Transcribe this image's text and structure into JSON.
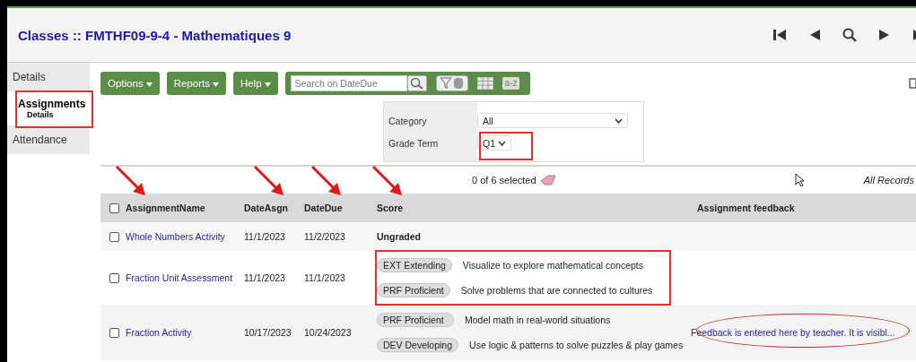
{
  "title": "Classes :: FMTHF09-9-4 - Mathematiques 9",
  "sidebar": {
    "items": [
      {
        "label": "Details",
        "selected": false
      },
      {
        "label": "Assignments",
        "sublabel": "Details",
        "selected": true
      },
      {
        "label": "Attendance",
        "selected": false
      }
    ]
  },
  "toolbar": {
    "menus": [
      "Options",
      "Reports",
      "Help"
    ],
    "search": {
      "placeholder": "Search on DateDue"
    },
    "sort_label": "a-z"
  },
  "filters": [
    {
      "label": "Category",
      "value": "All",
      "kind": "wide"
    },
    {
      "label": "Grade Term",
      "value": "Q1",
      "kind": "narrow"
    }
  ],
  "selection": "0 of 6 selected",
  "records": "All Records",
  "table": {
    "select_all_checked": false,
    "columns": [
      "AssignmentName",
      "DateAsgn",
      "DateDue",
      "Score",
      "Assignment feedback"
    ],
    "rows": [
      {
        "name": "Whole Numbers Activity",
        "date_asgn": "11/1/2023",
        "date_due": "11/2/2023",
        "checked": false,
        "score": "Ungraded"
      },
      {
        "name": "Fraction Unit Assessment",
        "date_asgn": "11/1/2023",
        "date_due": "11/1/2023",
        "checked": false,
        "scores": [
          {
            "badge": "EXT Extending",
            "description": "Visualize to explore mathematical concepts"
          },
          {
            "badge": "PRF Proficient",
            "description": "Solve problems that are connected to cultures"
          }
        ]
      },
      {
        "name": "Fraction Activity",
        "date_asgn": "10/17/2023",
        "date_due": "10/24/2023",
        "checked": false,
        "scores": [
          {
            "badge": "PRF Proficient",
            "description": "Model math in real-world situations"
          },
          {
            "badge": "DEV Developing",
            "description": "Use logic & patterns to solve puzzles & play games"
          }
        ],
        "feedback": "Feedback is entered here by teacher. It is visibl..."
      }
    ]
  }
}
